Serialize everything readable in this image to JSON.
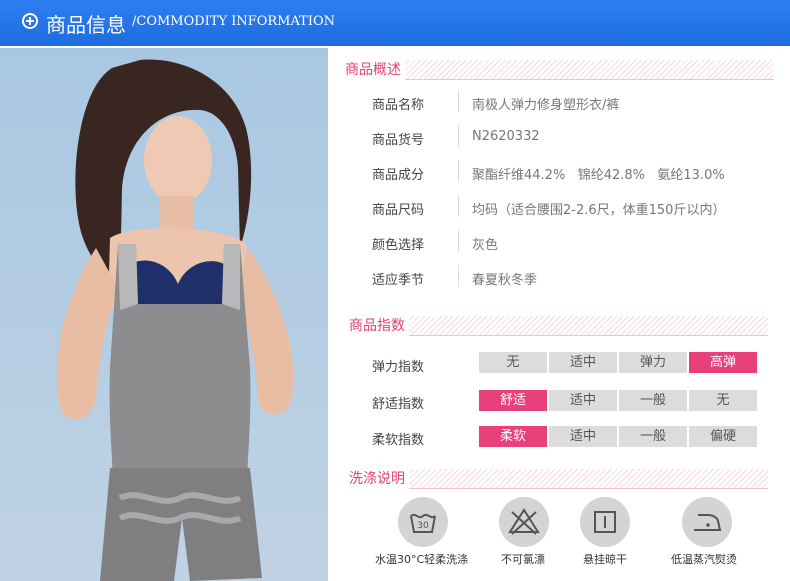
{
  "header": {
    "title": "商品信息",
    "subtitle": "/COMMODITY INFORMATION"
  },
  "overview": {
    "title": "商品概述",
    "rows": [
      {
        "label": "商品名称",
        "value": "南极人弹力修身塑形衣/裤"
      },
      {
        "label": "商品货号",
        "value": "N2620332"
      },
      {
        "label": "商品成分",
        "value": "聚酯纤维44.2%   锦纶42.8%   氨纶13.0%"
      },
      {
        "label": "商品尺码",
        "value": "均码（适合腰围2-2.6尺，体重150斤以内）"
      },
      {
        "label": "颜色选择",
        "value": "灰色"
      },
      {
        "label": "适应季节",
        "value": "春夏秋冬季"
      }
    ]
  },
  "index": {
    "title": "商品指数",
    "rows": [
      {
        "label": "弹力指数",
        "options": [
          "无",
          "适中",
          "弹力",
          "高弹"
        ],
        "selected": 3
      },
      {
        "label": "舒适指数",
        "options": [
          "舒适",
          "适中",
          "一般",
          "无"
        ],
        "selected": 0
      },
      {
        "label": "柔软指数",
        "options": [
          "柔软",
          "适中",
          "一般",
          "偏硬"
        ],
        "selected": 0
      }
    ]
  },
  "washing": {
    "title": "洗涤说明",
    "items": [
      {
        "icon": "wash-30-icon",
        "label": "水温30°C轻柔洗涤",
        "tub_text": "30"
      },
      {
        "icon": "no-bleach-icon",
        "label": "不可氯漂"
      },
      {
        "icon": "hang-dry-icon",
        "label": "悬挂晾干"
      },
      {
        "icon": "low-steam-iron-icon",
        "label": "低温蒸汽熨烫"
      }
    ]
  },
  "colors": {
    "accent": "#e8407a",
    "header": "#1e6ce0",
    "cell": "#dcdcdc"
  }
}
